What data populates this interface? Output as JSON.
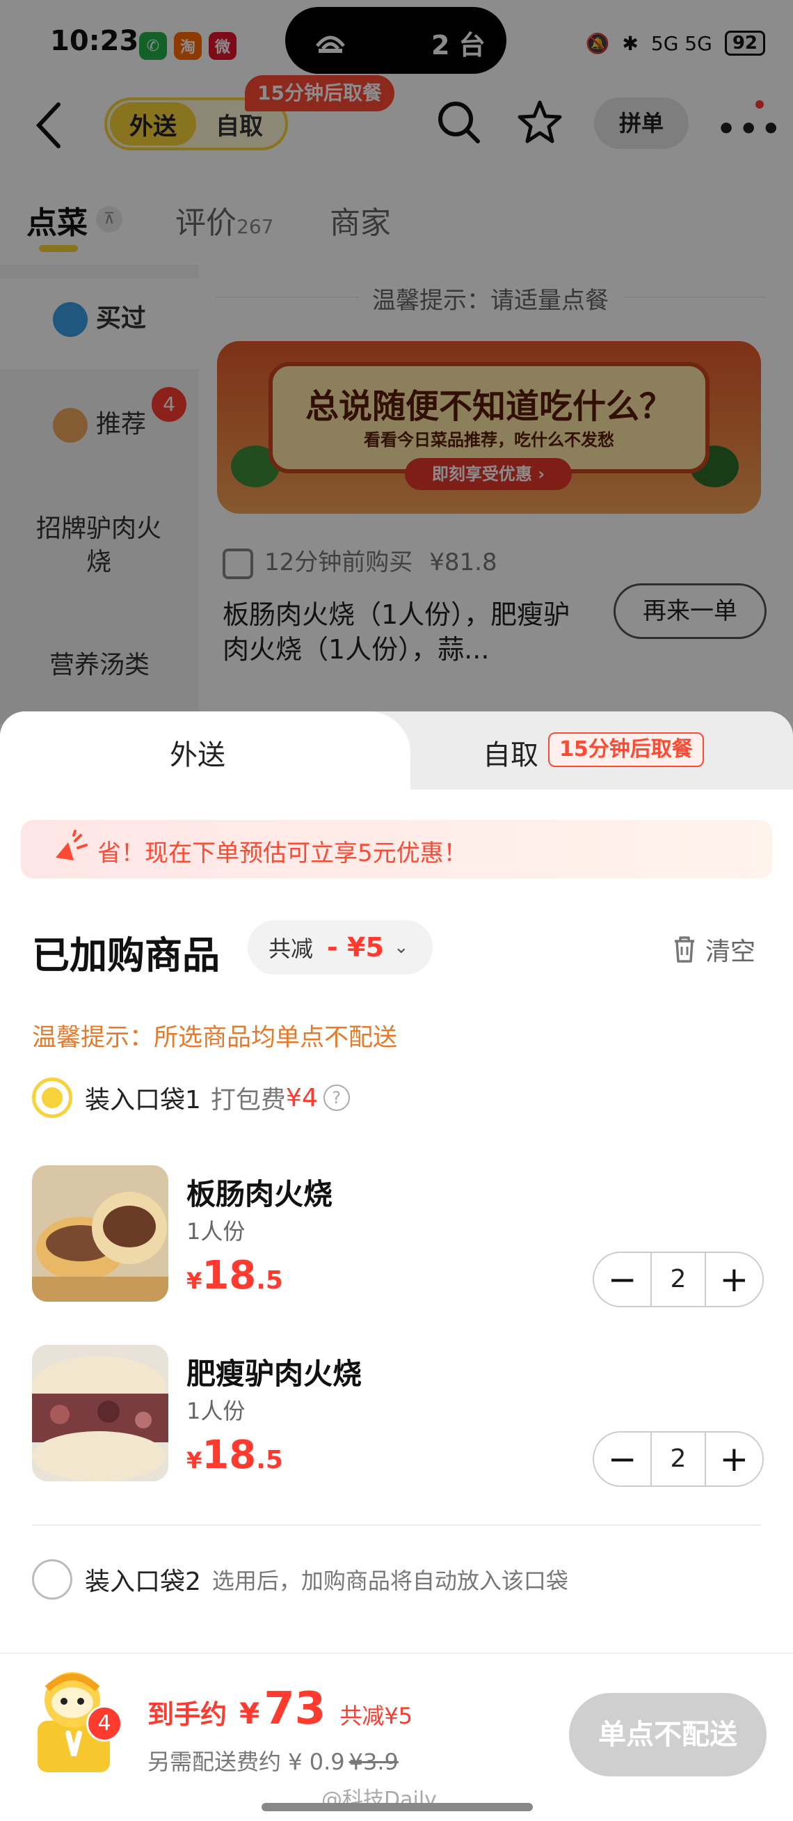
{
  "status_bar": {
    "time": "10:23",
    "island_count": "2 台",
    "network": "5G 5G",
    "battery": "92"
  },
  "header": {
    "mode_delivery": "外送",
    "mode_pickup": "自取",
    "pickup_badge": "15分钟后取餐",
    "group_order": "拼单"
  },
  "tabs": [
    {
      "label": "点菜",
      "count": ""
    },
    {
      "label": "评价",
      "count": "267"
    },
    {
      "label": "商家",
      "count": ""
    }
  ],
  "sidebar": {
    "items": [
      {
        "label": "买过"
      },
      {
        "label": "推荐",
        "badge": "4"
      },
      {
        "label": "招牌驴肉火烧"
      },
      {
        "label": "营养汤类"
      }
    ]
  },
  "menu": {
    "tip": "温馨提示：请适量点餐",
    "banner_title": "总说随便不知道吃什么？",
    "banner_sub": "看看今日菜品推荐，吃什么不发愁",
    "banner_button": "即刻享受优惠 ›",
    "recent_order_time": "12分钟前购买",
    "recent_order_price": "¥81.8",
    "recent_order_items": "板肠肉火烧（1人份），肥瘦驴肉火烧（1人份），蒜...",
    "reorder_button": "再来一单"
  },
  "sheet": {
    "tab_delivery": "外送",
    "tab_pickup": "自取",
    "tab_pickup_badge": "15分钟后取餐",
    "promo": "省！现在下单预估可立享5元优惠！",
    "cart_title": "已加购商品",
    "discount_label": "共减",
    "discount_value": "- ¥5",
    "clear_label": "清空",
    "warm_tip": "温馨提示：所选商品均单点不配送",
    "bag1_label": "装入口袋1",
    "bag1_fee_label": "打包费",
    "bag1_fee_value": "¥4",
    "items": [
      {
        "name": "板肠肉火烧",
        "spec": "1人份",
        "cur": "¥",
        "int": "18",
        "dec": ".5",
        "qty": "2"
      },
      {
        "name": "肥瘦驴肉火烧",
        "spec": "1人份",
        "cur": "¥",
        "int": "18",
        "dec": ".5",
        "qty": "2"
      }
    ],
    "bag2_label": "装入口袋2",
    "bag2_desc": "选用后，加购商品将自动放入该口袋"
  },
  "footer": {
    "cart_count": "4",
    "total_label": "到手约",
    "total_currency": "¥",
    "total_value": "73",
    "total_save": "共减¥5",
    "delivery_label": "另需配送费约 ¥ 0.9",
    "delivery_old": "¥3.9",
    "checkout_button": "单点不配送",
    "watermark": "@科技Daily"
  },
  "colors": {
    "accent_yellow": "#f7d23a",
    "price_red": "#ff3b2f",
    "tip_orange": "#e6792a"
  }
}
